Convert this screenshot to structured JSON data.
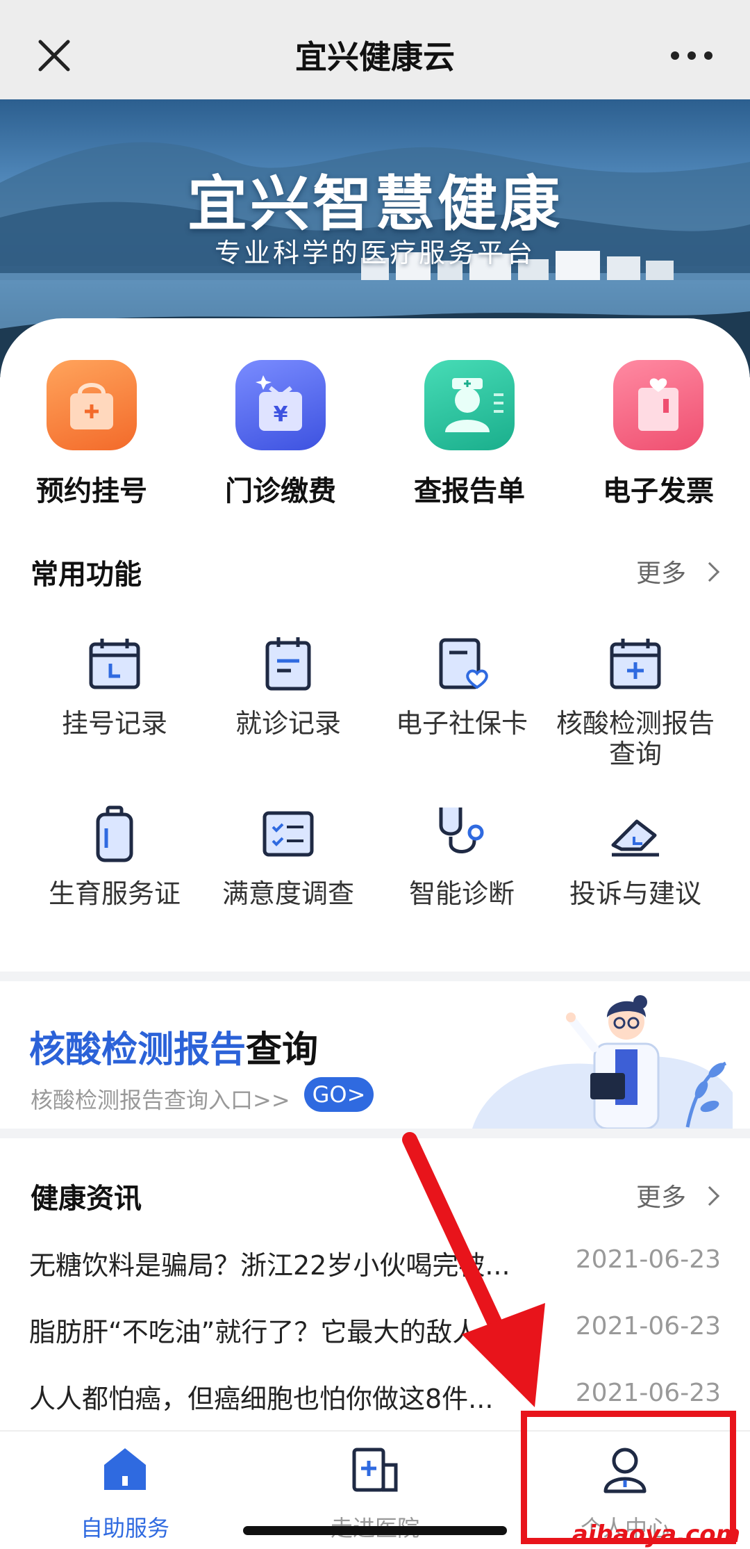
{
  "topbar": {
    "title": "宜兴健康云"
  },
  "banner": {
    "title": "宜兴智慧健康",
    "subtitle": "专业科学的医疗服务平台"
  },
  "quick_actions": [
    {
      "label": "预约挂号",
      "icon": "appointment-bag-icon",
      "color": "#f57b3e"
    },
    {
      "label": "门诊缴费",
      "icon": "payment-gift-icon",
      "color": "#5268f0"
    },
    {
      "label": "查报告单",
      "icon": "doctor-report-icon",
      "color": "#29c3a0"
    },
    {
      "label": "电子发票",
      "icon": "invoice-box-icon",
      "color": "#f05a78"
    }
  ],
  "common": {
    "title": "常用功能",
    "more": "更多",
    "items": [
      {
        "label": "挂号记录",
        "icon": "calendar-l-icon"
      },
      {
        "label": "就诊记录",
        "icon": "calendar-note-icon"
      },
      {
        "label": "电子社保卡",
        "icon": "card-heart-icon"
      },
      {
        "label": "核酸检测报告",
        "label2": "查询",
        "icon": "calendar-plus-icon"
      },
      {
        "label": "生育服务证",
        "icon": "bottle-icon"
      },
      {
        "label": "满意度调查",
        "icon": "checklist-icon"
      },
      {
        "label": "智能诊断",
        "icon": "stethoscope-icon"
      },
      {
        "label": "投诉与建议",
        "icon": "eraser-icon"
      }
    ]
  },
  "promo": {
    "title_highlight": "核酸检测报告",
    "title_rest": "查询",
    "subtitle": "核酸检测报告查询入口>>",
    "go": "GO>"
  },
  "news": {
    "title": "健康资讯",
    "more": "更多",
    "items": [
      {
        "title": "无糖饮料是骗局？浙江22岁小伙喝完被...",
        "date": "2021-06-23"
      },
      {
        "title": "脂肪肝“不吃油”就行了？它最大的敌人...",
        "date": "2021-06-23"
      },
      {
        "title": "人人都怕癌，但癌细胞也怕你做这8件...",
        "date": "2021-06-23"
      }
    ]
  },
  "tabs": [
    {
      "label": "自助服务",
      "active": true
    },
    {
      "label": "走进医院",
      "active": false
    },
    {
      "label": "个人中心",
      "active": false
    }
  ],
  "colors": {
    "accent": "#2f6ae0",
    "annotation": "#e8141b"
  },
  "watermark": "aibaoya.com"
}
